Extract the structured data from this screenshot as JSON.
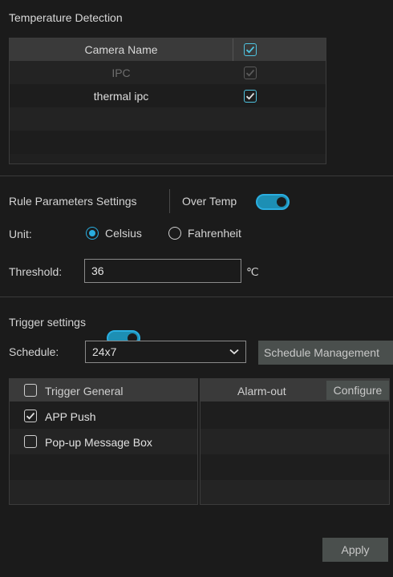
{
  "section_title": "Temperature Detection",
  "camera_table": {
    "header": "Camera Name",
    "rows": [
      {
        "name": "IPC",
        "checked": true,
        "disabled": true
      },
      {
        "name": "thermal ipc",
        "checked": true,
        "disabled": false
      }
    ]
  },
  "rule": {
    "title": "Rule Parameters Settings",
    "over_temp_label": "Over Temp",
    "over_temp_enabled": true,
    "unit_label": "Unit:",
    "unit_options": [
      "Celsius",
      "Fahrenheit"
    ],
    "unit_selected": "Celsius",
    "threshold_label": "Threshold:",
    "threshold_value": "36",
    "threshold_unit": "℃"
  },
  "trigger": {
    "label": "Trigger settings",
    "enabled": true,
    "schedule_label": "Schedule:",
    "schedule_value": "24x7",
    "schedule_mgmt_button": "Schedule Management",
    "general_header": "Trigger General",
    "general_items": [
      {
        "label": "APP Push",
        "checked": true
      },
      {
        "label": "Pop-up Message Box",
        "checked": false
      }
    ],
    "alarm_out_header": "Alarm-out",
    "configure_button": "Configure"
  },
  "apply_button": "Apply",
  "colors": {
    "accent": "#2aaee0",
    "background": "#1b1b1b"
  }
}
